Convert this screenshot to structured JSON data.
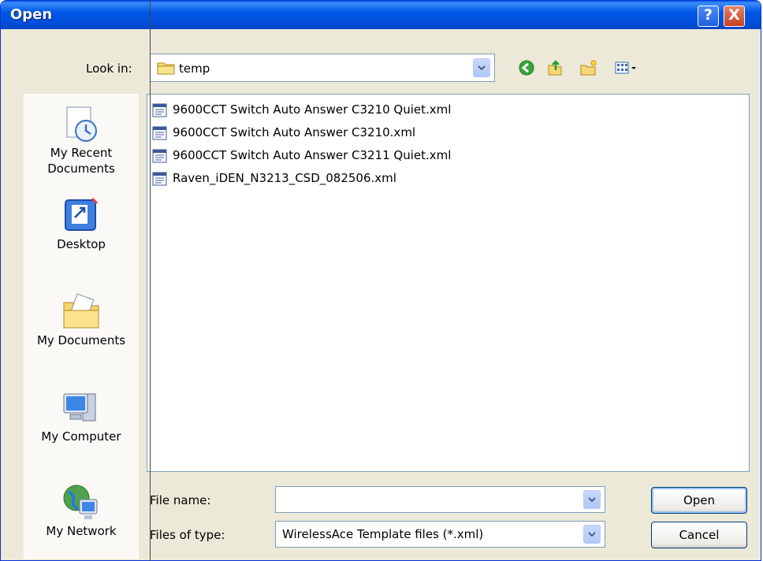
{
  "window": {
    "title": "Open"
  },
  "lookin": {
    "label": "Look in:",
    "value": "temp"
  },
  "toolbar": {
    "icons": [
      "back-icon",
      "up-folder-icon",
      "new-folder-icon",
      "views-menu-icon"
    ]
  },
  "places": [
    {
      "label_line1": "My Recent",
      "label_line2": "Documents",
      "icon": "recent-documents-icon"
    },
    {
      "label_line1": "Desktop",
      "label_line2": "",
      "icon": "desktop-icon"
    },
    {
      "label_line1": "My Documents",
      "label_line2": "",
      "icon": "my-documents-icon"
    },
    {
      "label_line1": "My Computer",
      "label_line2": "",
      "icon": "my-computer-icon"
    },
    {
      "label_line1": "My Network",
      "label_line2": "",
      "icon": "my-network-icon"
    }
  ],
  "files": [
    {
      "name": "9600CCT Switch Auto Answer C3210 Quiet.xml"
    },
    {
      "name": "9600CCT Switch Auto Answer C3210.xml"
    },
    {
      "name": "9600CCT Switch Auto Answer C3211 Quiet.xml"
    },
    {
      "name": "Raven_iDEN_N3213_CSD_082506.xml"
    }
  ],
  "filename": {
    "label": "File name:",
    "value": ""
  },
  "filetype": {
    "label": "Files of type:",
    "value": "WirelessAce Template files (*.xml)"
  },
  "buttons": {
    "open": "Open",
    "cancel": "Cancel",
    "help": "?",
    "close": "X"
  },
  "colors": {
    "titlebar": "#0054e3",
    "dialog_bg": "#ece9d8",
    "close": "#d7502b"
  }
}
